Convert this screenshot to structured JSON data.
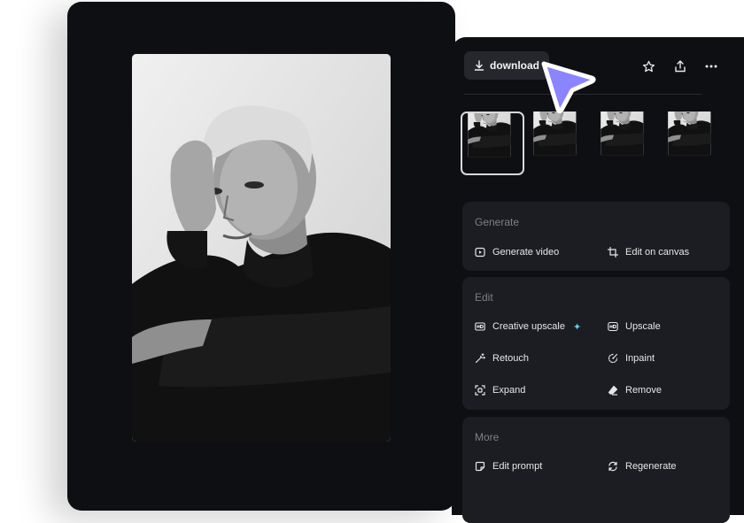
{
  "photo": {
    "description_icon": "portrait-photo"
  },
  "toolbar": {
    "download_label": "download",
    "icons": [
      "star-icon",
      "share-icon",
      "more-icon"
    ]
  },
  "thumbnails": {
    "count": 4,
    "selected_index": 0
  },
  "sections": {
    "generate": {
      "title": "Generate",
      "actions": [
        {
          "label": "Generate video",
          "icon": "play-square-icon"
        },
        {
          "label": "Edit on canvas",
          "icon": "crop-icon"
        }
      ]
    },
    "edit": {
      "title": "Edit",
      "actions": [
        {
          "label": "Creative upscale",
          "icon": "hd-plus-icon"
        },
        {
          "label": "Upscale",
          "icon": "hd-icon"
        },
        {
          "label": "Retouch",
          "icon": "magic-wand-icon"
        },
        {
          "label": "Inpaint",
          "icon": "inpaint-icon"
        },
        {
          "label": "Expand",
          "icon": "expand-icon"
        },
        {
          "label": "Remove",
          "icon": "eraser-icon"
        }
      ]
    },
    "more": {
      "title": "More",
      "actions": [
        {
          "label": "Edit prompt",
          "icon": "edit-prompt-icon"
        },
        {
          "label": "Regenerate",
          "icon": "refresh-icon"
        }
      ]
    }
  },
  "colors": {
    "card_bg": "#0e0f12",
    "section_bg": "#1c1d22",
    "cursor": "#8b84ff",
    "sparkle": "#5fd3f3"
  }
}
